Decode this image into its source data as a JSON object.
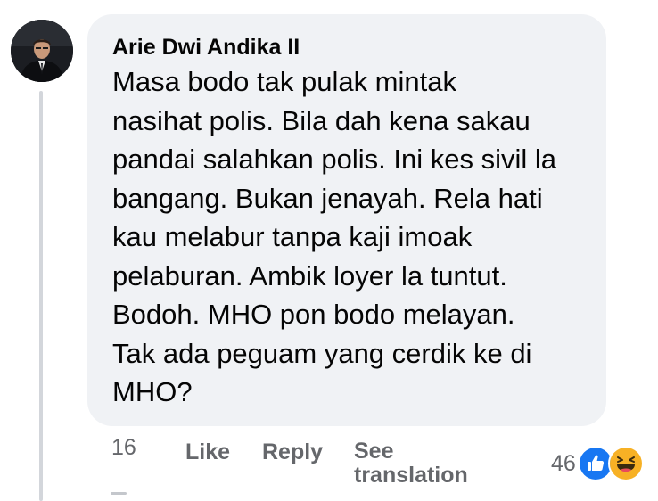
{
  "comment": {
    "author": "Arie Dwi Andika II",
    "text": "Masa bodo tak pulak mintak\nnasihat polis. Bila dah kena sakau\npandai salahkan polis. Ini kes sivil la\nbangang. Bukan jenayah. Rela hati\nkau melabur tanpa kaji imoak\npelaburan. Ambik loyer la tuntut.\nBodoh. MHO pon bodo melayan.\nTak ada peguam yang cerdik ke di\nMHO?",
    "timestamp": "16",
    "actions": {
      "like": "Like",
      "reply": "Reply",
      "see_translation": "See translation"
    },
    "reactions": {
      "count": "46",
      "icons": [
        "like-reaction-icon",
        "haha-reaction-icon"
      ]
    }
  },
  "colors": {
    "bubble_bg": "#f0f2f5",
    "meta_text": "#65676b",
    "like_blue": "#1877f2",
    "haha_yellow": "#f7b125"
  }
}
